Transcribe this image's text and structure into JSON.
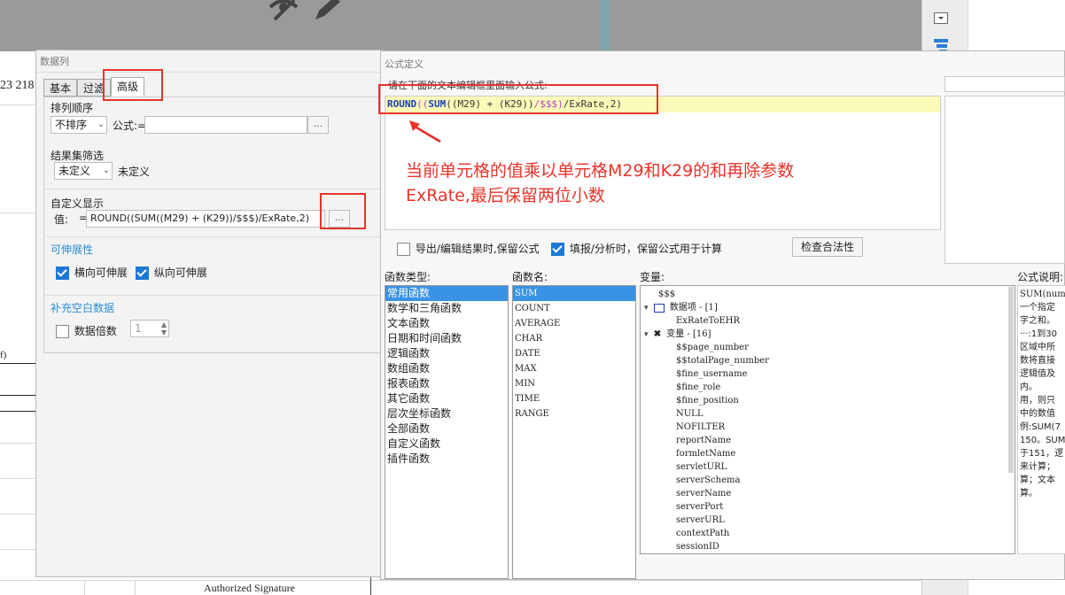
{
  "background": {
    "row_numbers": "23 218",
    "footer_signature": "Authorized Signature",
    "paren_fragment": "f)"
  },
  "data_column_dialog": {
    "title": "数据列",
    "tabs": [
      "基本",
      "过滤",
      "高级"
    ],
    "sort": {
      "section": "排列顺序",
      "value": "不排序",
      "formula_label": "公式:=",
      "dots": "..."
    },
    "filter": {
      "section": "结果集筛选",
      "value": "未定义",
      "text": "未定义"
    },
    "custom_display": {
      "section": "自定义显示",
      "value_label": "值:",
      "eq": "=",
      "value": "ROUND((SUM((M29) + (K29))/$$$)/ExRate,2)",
      "dots": "..."
    },
    "expand": {
      "section": "可伸展性",
      "horizontal": "横向可伸展",
      "vertical": "纵向可伸展"
    },
    "fill": {
      "section": "补充空白数据",
      "label": "数据倍数",
      "value": "1"
    }
  },
  "formula_dialog": {
    "title": "公式定义",
    "prompt": "请在下面的文本编辑框里面输入公式:",
    "formula_parts": [
      "ROUND",
      "((",
      "SUM",
      "((M29) + (K29))",
      "/$$$)",
      "/ExRate,2)"
    ],
    "annotation_line1": "当前单元格的值乘以单元格M29和K29的和再除参数",
    "annotation_line2": "ExRate,最后保留两位小数",
    "export_checkbox": "导出/编辑结果时,保留公式",
    "fill_checkbox": "填报/分析时，保留公式用于计算",
    "check_button": "检查合法性",
    "func_type_label": "函数类型:",
    "func_name_label": "函数名:",
    "variable_label": "变量:",
    "desc_label": "公式说明:",
    "func_types": [
      "常用函数",
      "数学和三角函数",
      "文本函数",
      "日期和时间函数",
      "逻辑函数",
      "数组函数",
      "报表函数",
      "其它函数",
      "层次坐标函数",
      "全部函数",
      "自定义函数",
      "插件函数"
    ],
    "func_names": [
      "SUM",
      "COUNT",
      "AVERAGE",
      "CHAR",
      "DATE",
      "MAX",
      "MIN",
      "TIME",
      "RANGE"
    ],
    "variables": {
      "root": "$$$",
      "data_items": "数据项 - [1]",
      "data_child": "ExRateToEHR",
      "vars": "变量 - [16]",
      "var_children": [
        "$$page_number",
        "$$totalPage_number",
        "$fine_username",
        "$fine_role",
        "$fine_position",
        "NULL",
        "NOFILTER",
        "reportName",
        "formletName",
        "servletURL",
        "serverSchema",
        "serverName",
        "serverPort",
        "serverURL",
        "contextPath",
        "sessionID"
      ]
    },
    "description_lines": [
      "SUM(numb",
      "一个指定",
      "字之和。",
      "···:1到30",
      "区域中所",
      "数将直接",
      "逻辑值及",
      "内。",
      "用，则只",
      "中的数值",
      "例:SUM(7",
      "150。SUM",
      "于151，逻",
      "来计算；",
      "算；文本",
      "算。"
    ]
  },
  "colors": {
    "accent": "#2a8fd0",
    "selection": "#3a92e4",
    "annotation": "#e8332a",
    "formula_bg": "#fbfbb9"
  }
}
